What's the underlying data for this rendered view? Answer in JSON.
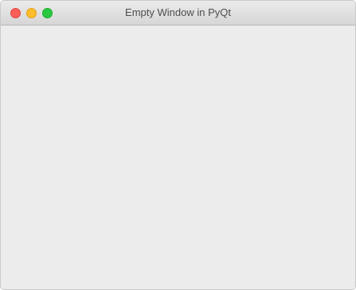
{
  "window": {
    "title": "Empty Window in PyQt"
  },
  "traffic_lights": {
    "close_color": "#fd5e57",
    "minimize_color": "#febc2e",
    "zoom_color": "#29c840"
  },
  "colors": {
    "content_background": "#ececec"
  }
}
